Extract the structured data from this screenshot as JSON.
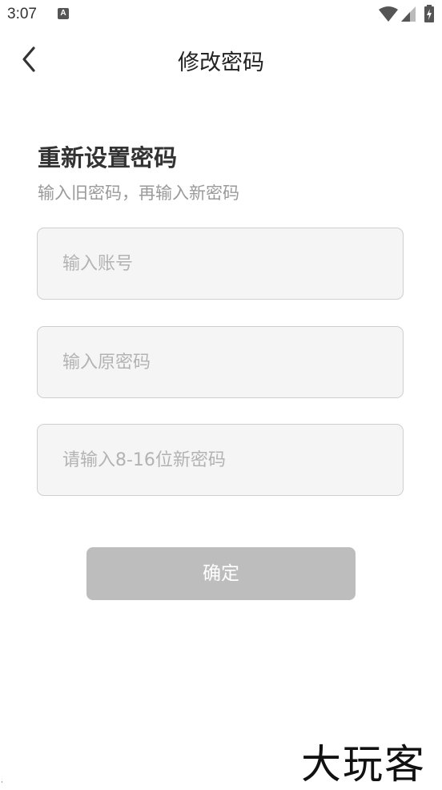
{
  "status_bar": {
    "time": "3:07",
    "notification_icon": "android-notification-icon",
    "notification_glyph": "A",
    "wifi_icon": "wifi-icon",
    "signal_icon": "cell-signal-icon",
    "battery_icon": "battery-charging-icon"
  },
  "nav": {
    "back_icon": "chevron-left-icon",
    "title": "修改密码"
  },
  "form": {
    "heading": "重新设置密码",
    "subheading": "输入旧密码，再输入新密码",
    "account_placeholder": "输入账号",
    "old_password_placeholder": "输入原密码",
    "new_password_placeholder": "请输入8-16位新密码",
    "account_value": "",
    "old_password_value": "",
    "new_password_value": ""
  },
  "confirm_label": "确定",
  "watermark": "大玩客",
  "colors": {
    "field_background": "#f5f5f5",
    "field_border": "#cfcfcf",
    "button_disabled": "#bdbdbd",
    "placeholder": "#b3b3b3"
  }
}
